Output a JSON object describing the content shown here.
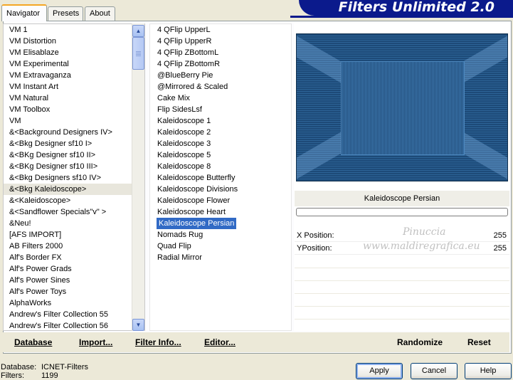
{
  "tabs": [
    "Navigator",
    "Presets",
    "About"
  ],
  "app_title": "Filters Unlimited 2.0",
  "categories": {
    "items": [
      "VM 1",
      "VM Distortion",
      "VM Elisablaze",
      "VM Experimental",
      "VM Extravaganza",
      "VM Instant Art",
      "VM Natural",
      "VM Toolbox",
      "VM",
      "&<Background Designers IV>",
      "&<Bkg Designer sf10 I>",
      "&<BKg Designer sf10 II>",
      "&<BKg Designer sf10 III>",
      "&<Bkg Designers sf10 IV>",
      "&<Bkg Kaleidoscope>",
      "&<Kaleidoscope>",
      "&<Sandflower Specials\"v\" >",
      "&Neu!",
      "[AFS IMPORT]",
      "AB Filters 2000",
      "Alf's Border FX",
      "Alf's Power Grads",
      "Alf's Power Sines",
      "Alf's Power Toys",
      "AlphaWorks",
      "Andrew's Filter Collection 55",
      "Andrew's Filter Collection 56"
    ],
    "selected_index": 14
  },
  "filters": {
    "items": [
      "4 QFlip UpperL",
      "4 QFlip UpperR",
      "4 QFlip ZBottomL",
      "4 QFlip ZBottomR",
      "@BlueBerry Pie",
      "@Mirrored & Scaled",
      "Cake Mix",
      "Flip SidesLsf",
      "Kaleidoscope 1",
      "Kaleidoscope 2",
      "Kaleidoscope 3",
      "Kaleidoscope 5",
      "Kaleidoscope 8",
      "Kaleidoscope Butterfly",
      "Kaleidoscope Divisions",
      "Kaleidoscope Flower",
      "Kaleidoscope Heart",
      "Kaleidoscope Persian",
      "Nomads Rug",
      "Quad Flip",
      "Radial Mirror"
    ],
    "selected_index": 17
  },
  "preview": {
    "filter_name": "Kaleidoscope Persian",
    "progress_percent": 0
  },
  "params": [
    {
      "label": "X Position:",
      "value": "255"
    },
    {
      "label": "YPosition:",
      "value": "255"
    }
  ],
  "watermark": {
    "line1": "Pinuccia",
    "line2": "www.maldiregrafica.eu"
  },
  "bottom_buttons": {
    "database": "Database",
    "import": "Import...",
    "filter_info": "Filter Info...",
    "editor": "Editor...",
    "randomize": "Randomize",
    "reset": "Reset"
  },
  "status": {
    "database_label": "Database:",
    "database_value": "ICNET-Filters",
    "filters_label": "Filters:",
    "filters_value": "1199"
  },
  "dialog_buttons": {
    "apply": "Apply",
    "cancel": "Cancel",
    "help": "Help"
  },
  "colors": {
    "selection": "#316ac5",
    "banner": "#0b1a8c",
    "preview": "#2d6497"
  }
}
